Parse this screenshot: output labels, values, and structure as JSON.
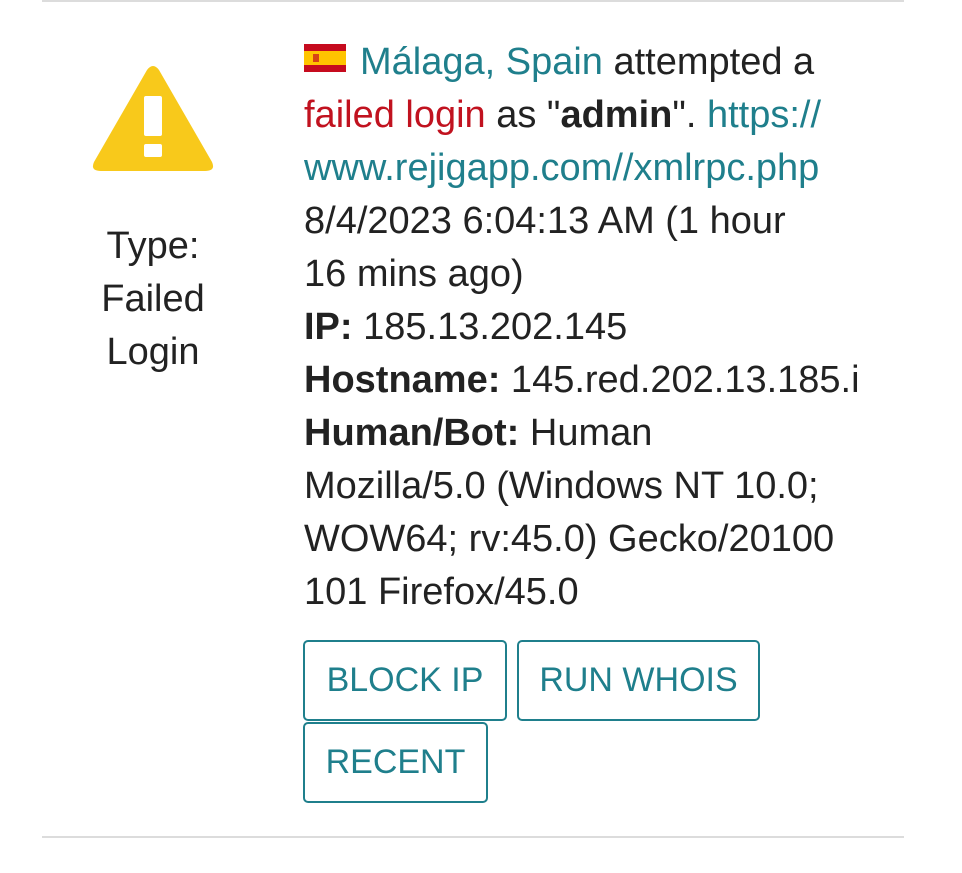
{
  "event": {
    "type_label": "Type:",
    "type_value_line1": "Failed",
    "type_value_line2": "Login",
    "flag_icon": "spain-flag-icon",
    "location": "Málaga, Spain",
    "attempted_text": " attempted a",
    "failed_login_text": "failed login",
    "as_text": " as \"",
    "username": "admin",
    "after_username_text": "\". ",
    "url_part1": "https://",
    "url_part2": "www.rejigapp.com//xmlrpc.php",
    "timestamp_line1": "8/4/2023 6:04:13 AM (1 hour",
    "timestamp_line2": "16 mins ago)",
    "ip_label": "IP:",
    "ip_value": " 185.13.202.145",
    "hostname_label": "Hostname:",
    "hostname_value": " 145.red.202.13.185.i",
    "humanbot_label": "Human/Bot:",
    "humanbot_value": " Human",
    "ua_line1": "Mozilla/5.0 (Windows NT 10.0;",
    "ua_line2": "WOW64; rv:45.0) Gecko/20100",
    "ua_line3": "101 Firefox/45.0"
  },
  "actions": {
    "block_ip_label": "BLOCK IP",
    "run_whois_label": "RUN WHOIS",
    "recent_label": "RECENT"
  },
  "colors": {
    "accent_teal": "#1f7f8c",
    "failed_red": "#c1121f",
    "warning_yellow": "#f8c91b",
    "divider": "#dcdcdc"
  },
  "icons": {
    "warning": "warning-triangle-icon"
  }
}
